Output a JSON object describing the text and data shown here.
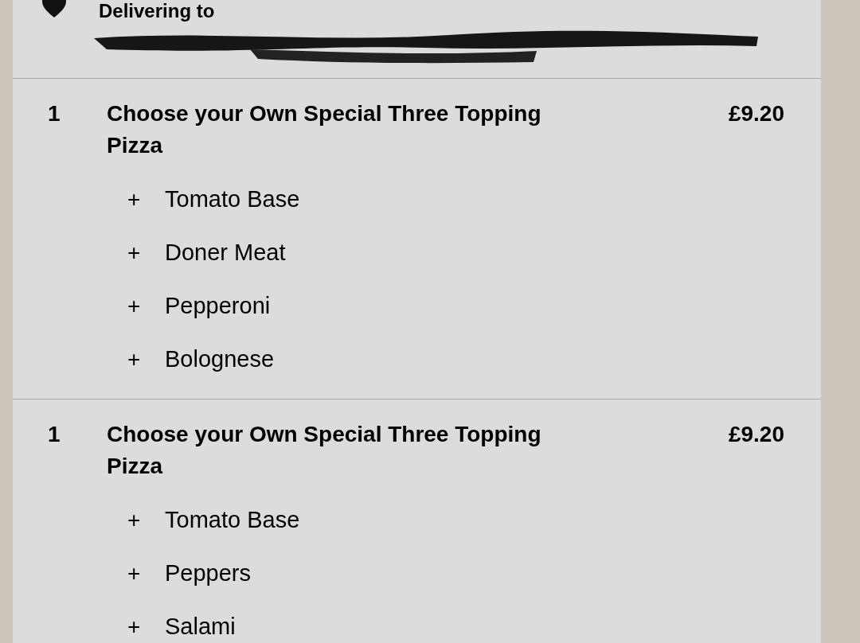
{
  "delivery": {
    "label": "Delivering to"
  },
  "items": [
    {
      "quantity": "1",
      "name": "Choose your Own Special Three Topping Pizza",
      "price": "£9.20",
      "options": [
        "Tomato Base",
        "Doner Meat",
        "Pepperoni",
        "Bolognese"
      ],
      "option_sign": "+"
    },
    {
      "quantity": "1",
      "name": "Choose your Own Special Three Topping Pizza",
      "price": "£9.20",
      "options": [
        "Tomato Base",
        "Peppers",
        "Salami"
      ],
      "option_sign": "+"
    }
  ]
}
